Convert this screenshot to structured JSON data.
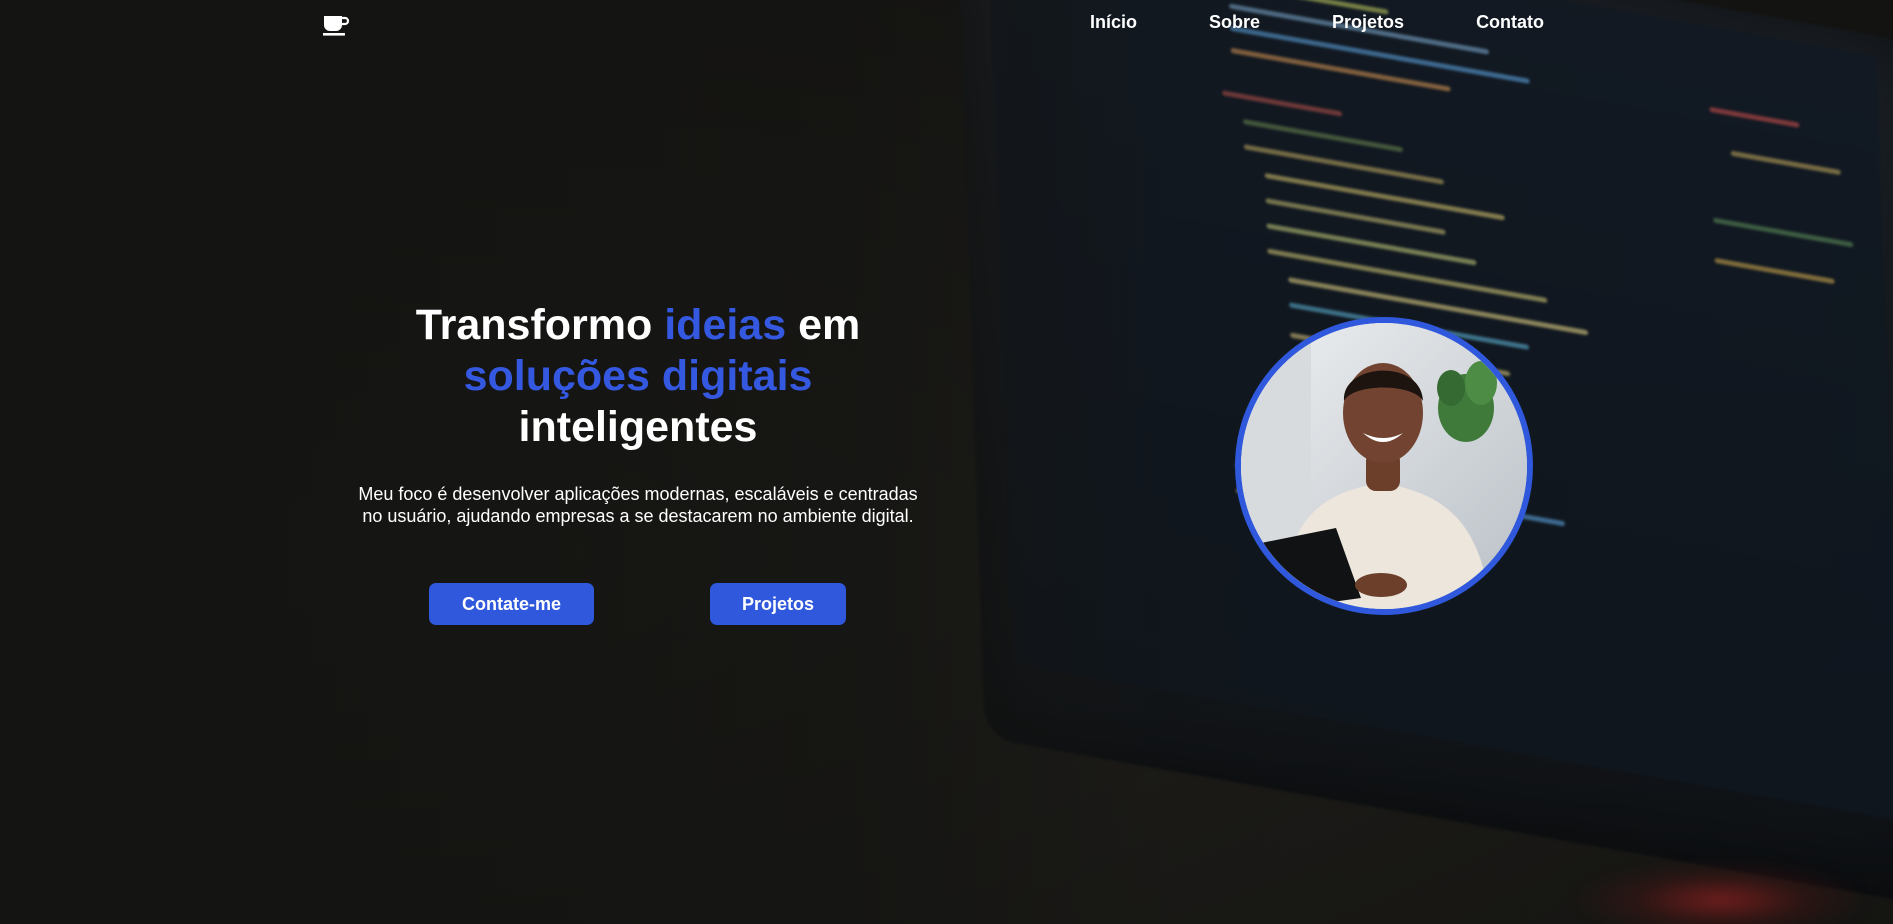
{
  "nav": {
    "logo_icon": "coffee-cup-icon",
    "links": [
      "Início",
      "Sobre",
      "Projetos",
      "Contato"
    ]
  },
  "hero": {
    "headline": {
      "part1": "Transformo ",
      "part2": "ideias",
      "part3": " em",
      "part4": "soluções digitais",
      "part5": "inteligentes"
    },
    "subtext": "Meu foco é desenvolver aplicações modernas, escaláveis e centradas no usuário, ajudando empresas a se destacarem no ambiente digital.",
    "buttons": {
      "contact": "Contate-me",
      "projects": "Projetos"
    }
  },
  "colors": {
    "accent": "#2f58dc",
    "text": "#ffffff",
    "background": "#1a1a18"
  }
}
